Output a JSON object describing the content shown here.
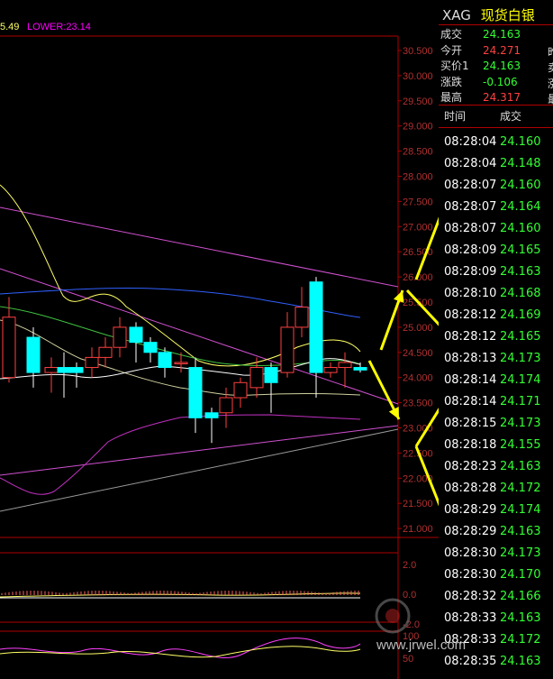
{
  "symbol": {
    "code": "XAG",
    "name": "现货白银"
  },
  "indicator": {
    "prev_value": "5.49",
    "lower": "LOWER:23.14",
    "lower_color": "#ff00ff"
  },
  "quote": [
    {
      "key": "成交",
      "value": "24.163",
      "color": "#33ff33",
      "cut": ""
    },
    {
      "key": "今开",
      "value": "24.271",
      "color": "#ff4040",
      "cut": "昨"
    },
    {
      "key": "买价1",
      "value": "24.163",
      "color": "#33ff33",
      "cut": "卖"
    },
    {
      "key": "涨跌",
      "value": "-0.106",
      "color": "#33ff33",
      "cut": "涨"
    },
    {
      "key": "最高",
      "value": "24.317",
      "color": "#ff4040",
      "cut": "最"
    }
  ],
  "tick_header": {
    "time": "时间",
    "price": "成交"
  },
  "ticks": [
    {
      "time": "08:28:04",
      "price": "24.160"
    },
    {
      "time": "08:28:04",
      "price": "24.148"
    },
    {
      "time": "08:28:07",
      "price": "24.160"
    },
    {
      "time": "08:28:07",
      "price": "24.164"
    },
    {
      "time": "08:28:07",
      "price": "24.160"
    },
    {
      "time": "08:28:09",
      "price": "24.165"
    },
    {
      "time": "08:28:09",
      "price": "24.163"
    },
    {
      "time": "08:28:10",
      "price": "24.168"
    },
    {
      "time": "08:28:12",
      "price": "24.169"
    },
    {
      "time": "08:28:12",
      "price": "24.165"
    },
    {
      "time": "08:28:13",
      "price": "24.173"
    },
    {
      "time": "08:28:14",
      "price": "24.174"
    },
    {
      "time": "08:28:14",
      "price": "24.171"
    },
    {
      "time": "08:28:15",
      "price": "24.173"
    },
    {
      "time": "08:28:18",
      "price": "24.155"
    },
    {
      "time": "08:28:23",
      "price": "24.163"
    },
    {
      "time": "08:28:28",
      "price": "24.172"
    },
    {
      "time": "08:28:29",
      "price": "24.174"
    },
    {
      "time": "08:28:29",
      "price": "24.163"
    },
    {
      "time": "08:28:30",
      "price": "24.173"
    },
    {
      "time": "08:28:30",
      "price": "24.170"
    },
    {
      "time": "08:28:32",
      "price": "24.166"
    },
    {
      "time": "08:28:33",
      "price": "24.163"
    },
    {
      "time": "08:28:33",
      "price": "24.172"
    },
    {
      "time": "08:28:35",
      "price": "24.163"
    }
  ],
  "price_axis": [
    "30.500",
    "30.000",
    "29.500",
    "29.000",
    "28.500",
    "28.000",
    "27.500",
    "27.000",
    "26.500",
    "26.000",
    "25.500",
    "25.000",
    "24.500",
    "24.000",
    "23.500",
    "23.000",
    "22.500",
    "22.000",
    "21.500",
    "21.000"
  ],
  "macd_axis": [
    "2.0",
    "0.0",
    "-2.0"
  ],
  "kdj_axis": [
    "100",
    "50"
  ],
  "watermark": {
    "url": "www.jrwel.com",
    "icon": "jinrongjie-logo-icon"
  },
  "colors": {
    "axis": "#b00000",
    "up": "#ff4040",
    "down": "#00ffff",
    "arrow": "#ffff00"
  }
}
